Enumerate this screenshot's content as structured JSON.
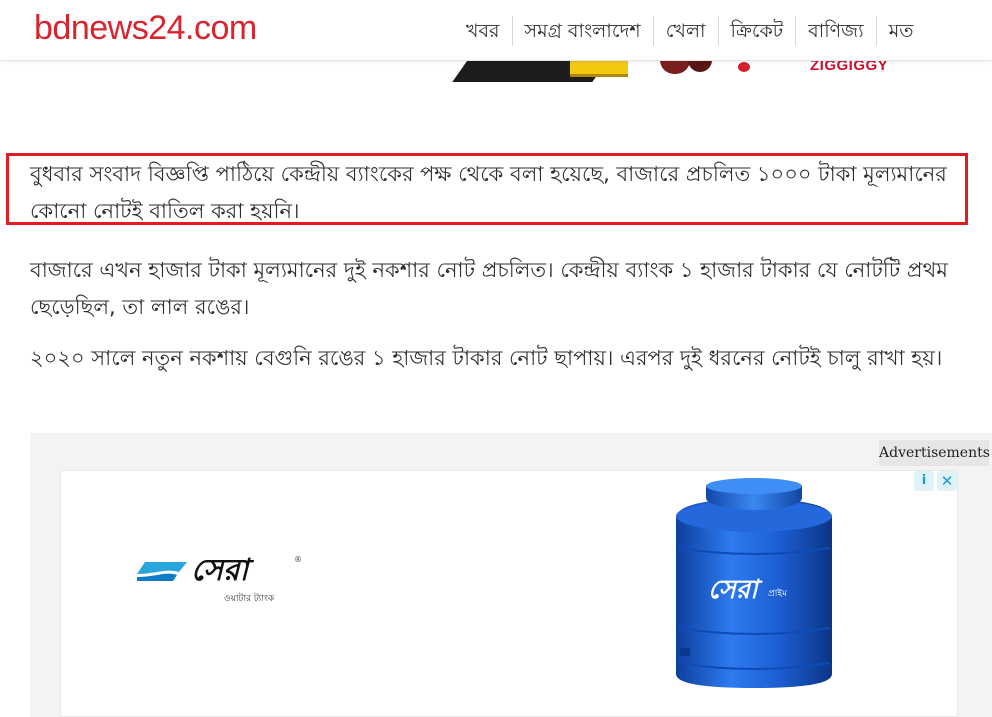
{
  "header": {
    "logo": "bdnews24.com",
    "nav": [
      "খবর",
      "সমগ্র বাংলাদেশ",
      "খেলা",
      "ক্রিকেট",
      "বাণিজ্য",
      "মত"
    ]
  },
  "top_ad": {
    "brand": "ZIGGIGGY"
  },
  "article": {
    "paragraphs": [
      "বুধবার সংবাদ বিজ্ঞপ্তি পাঠিয়ে কেন্দ্রীয় ব্যাংকের পক্ষ থেকে বলা হয়েছে, বাজারে প্রচলিত ১০০০ টাকা মূল্যমানের কোনো নোটই বাতিল করা হয়নি।",
      "বাজারে এখন হাজার টাকা মূল্যমানের দুই নকশার নোট প্রচলিত। কেন্দ্রীয় ব্যাংক ১ হাজার টাকার যে নোটটি প্রথম ছেড়েছিল, তা লাল রঙের।",
      "২০২০ সালে নতুন নকশায় বেগুনি রঙের ১ হাজার টাকার নোট ছাপায়। এরপর দুই ধরনের নোটই চালু রাখা হয়।"
    ],
    "highlight_color": "#e01b22"
  },
  "advertisement": {
    "label": "Advertisements",
    "info_icon": "i",
    "close_icon": "✕",
    "brand_name": "সেরা",
    "brand_reg": "®",
    "brand_tagline": "ওয়াটার ট্যাংক",
    "tank_label": "সেরা",
    "tank_sublabel": "প্রাইম",
    "tank_color": "#1e63d6"
  },
  "colors": {
    "logo_red": "#d9232d",
    "text": "#2d2d2d"
  }
}
